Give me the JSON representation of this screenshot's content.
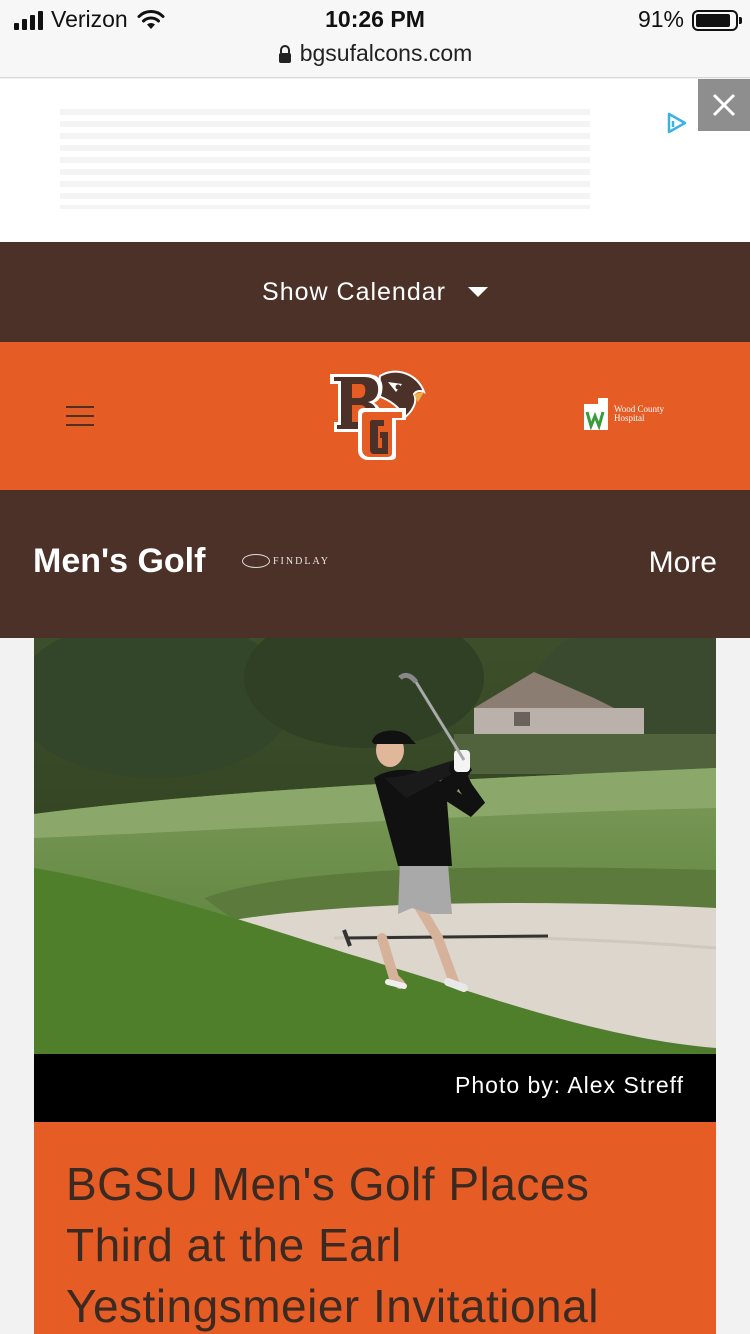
{
  "status_bar": {
    "carrier": "Verizon",
    "time": "10:26 PM",
    "battery": "91%",
    "url": "bgsufalcons.com"
  },
  "ad": {
    "close_icon": "close-icon",
    "adchoices_icon": "adchoices-icon"
  },
  "calendar": {
    "label": "Show Calendar",
    "icon": "caret-down-icon"
  },
  "header": {
    "menu_icon": "hamburger-icon",
    "logo_text": "BG",
    "sponsor_line1": "Wood County",
    "sponsor_line2": "Hospital"
  },
  "section": {
    "title": "Men's Golf",
    "sponsor": "FINDLAY",
    "more_label": "More"
  },
  "article": {
    "photo_credit": "Photo by: Alex Streff",
    "headline": "BGSU Men's Golf Places Third at the Earl Yestingsmeier Invitational"
  },
  "colors": {
    "brown": "#4b3127",
    "orange": "#e65c25"
  }
}
